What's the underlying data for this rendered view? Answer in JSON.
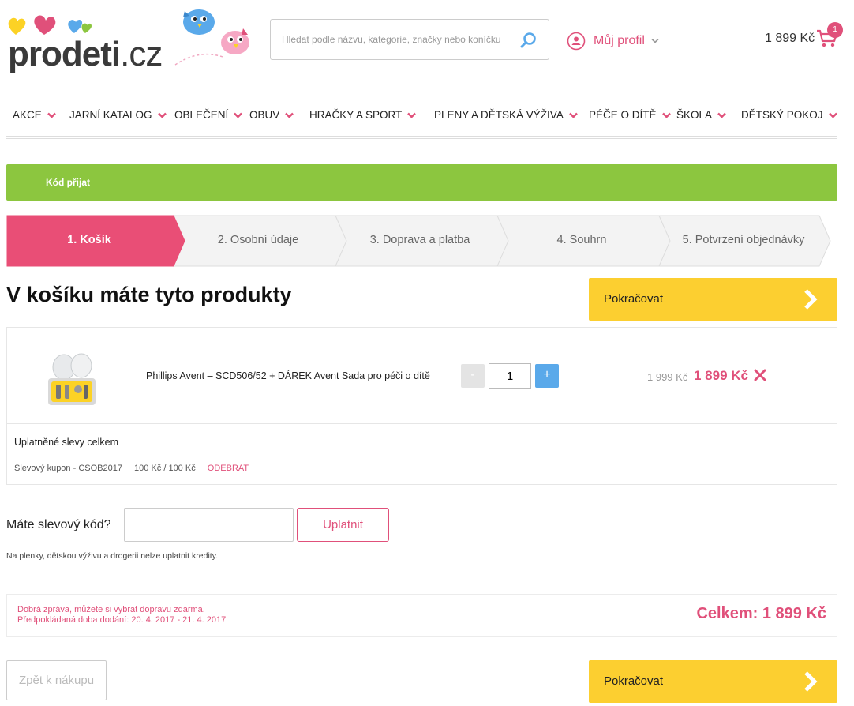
{
  "header": {
    "logo_text": "prodeti",
    "logo_tld": ".cz",
    "search_placeholder": "Hledat podle názvu, kategorie, značky nebo koníčku",
    "profile_label": "Můj profil",
    "cart_total": "1 899 Kč",
    "cart_count": "1"
  },
  "nav": {
    "items": [
      {
        "label": "AKCE"
      },
      {
        "label": "JARNÍ KATALOG"
      },
      {
        "label": "OBLEČENÍ"
      },
      {
        "label": "OBUV"
      },
      {
        "label": "HRAČKY A SPORT"
      },
      {
        "label": "PLENY A DĚTSKÁ VÝŽIVA"
      },
      {
        "label": "PÉČE O DÍTĚ"
      },
      {
        "label": "ŠKOLA"
      },
      {
        "label": "DĚTSKÝ POKOJ"
      }
    ]
  },
  "notice": {
    "text": "Kód přijat"
  },
  "steps": [
    {
      "label": "1. Košík",
      "active": true
    },
    {
      "label": "2. Osobní údaje",
      "active": false
    },
    {
      "label": "3. Doprava a platba",
      "active": false
    },
    {
      "label": "4. Souhrn",
      "active": false
    },
    {
      "label": "5. Potvrzení objednávky",
      "active": false
    }
  ],
  "cart": {
    "title": "V košíku máte tyto produkty",
    "continue_label": "Pokračovat",
    "items": [
      {
        "name": "Phillips Avent – SCD506/52 + DÁREK Avent Sada pro péči o dítě",
        "quantity": "1",
        "old_price": "1 999 Kč",
        "price": "1 899 Kč"
      }
    ],
    "qty_minus": "-",
    "qty_plus": "+",
    "discounts_title": "Uplatněné slevy celkem",
    "discount": {
      "name": "Slevový kupon - CSOB2017",
      "amount": "100 Kč / 100 Kč",
      "remove_label": "ODEBRAT"
    }
  },
  "coupon": {
    "label": "Máte slevový kód?",
    "input_value": "",
    "apply_label": "Uplatnit",
    "note": "Na plenky, dětskou výživu a drogerii nelze uplatnit kredity."
  },
  "summary": {
    "free_shipping": "Dobrá zpráva, můžete si vybrat dopravu zdarma.",
    "delivery": "Předpokládaná doba dodání: 20. 4. 2017 - 21. 4. 2017",
    "total": "Celkem: 1 899 Kč"
  },
  "footer": {
    "back_label": "Zpět k nákupu",
    "continue_label": "Pokračovat"
  },
  "colors": {
    "accent": "#e0507a",
    "success": "#8cc63f",
    "cta": "#fccf30",
    "plus": "#5aa9ea"
  }
}
